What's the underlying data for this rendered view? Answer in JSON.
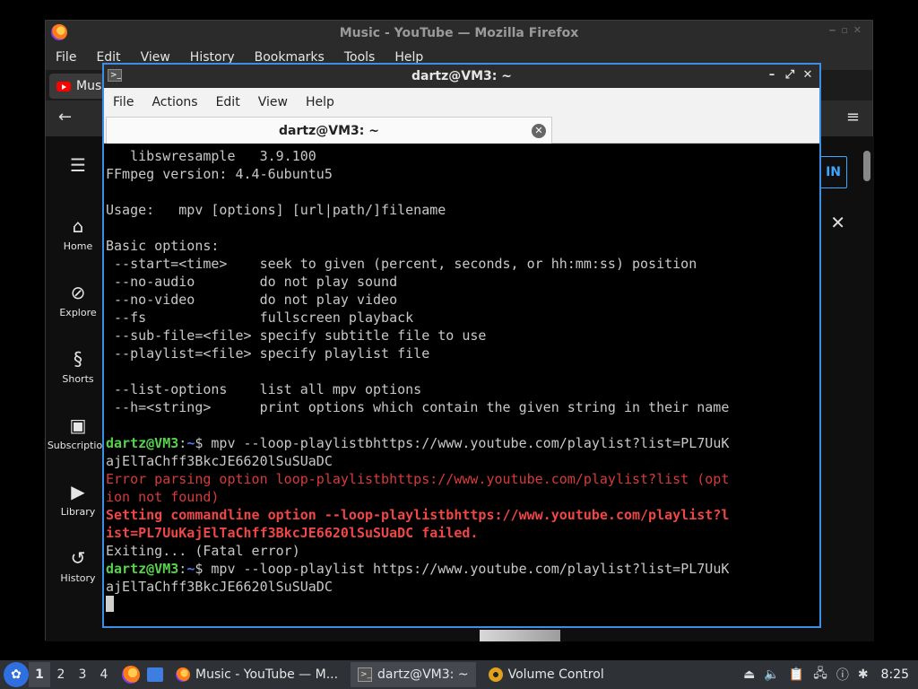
{
  "firefox": {
    "title": "Music - YouTube — Mozilla Firefox",
    "menu": [
      "File",
      "Edit",
      "View",
      "History",
      "Bookmarks",
      "Tools",
      "Help"
    ],
    "tab_label": "Musi",
    "youtube": {
      "sidebar": [
        {
          "label": "Home",
          "icon": "home-icon",
          "glyph": "⌂"
        },
        {
          "label": "Explore",
          "icon": "compass-icon",
          "glyph": "⊘"
        },
        {
          "label": "Shorts",
          "icon": "shorts-icon",
          "glyph": "§"
        },
        {
          "label": "Subscription",
          "icon": "subscriptions-icon",
          "glyph": "▣"
        },
        {
          "label": "Library",
          "icon": "library-icon",
          "glyph": "▶"
        },
        {
          "label": "History",
          "icon": "history-icon",
          "glyph": "↺"
        }
      ],
      "signin_partial": "IN"
    }
  },
  "terminal": {
    "title": "dartz@VM3: ~",
    "menu": [
      "File",
      "Actions",
      "Edit",
      "View",
      "Help"
    ],
    "tab_title": "dartz@VM3: ~",
    "lines": [
      {
        "segments": [
          {
            "text": "   libswresample   3.9.100",
            "cls": ""
          }
        ]
      },
      {
        "segments": [
          {
            "text": "FFmpeg version: 4.4-6ubuntu5",
            "cls": ""
          }
        ]
      },
      {
        "segments": [
          {
            "text": "",
            "cls": ""
          }
        ]
      },
      {
        "segments": [
          {
            "text": "Usage:   mpv [options] [url|path/]filename",
            "cls": ""
          }
        ]
      },
      {
        "segments": [
          {
            "text": "",
            "cls": ""
          }
        ]
      },
      {
        "segments": [
          {
            "text": "Basic options:",
            "cls": ""
          }
        ]
      },
      {
        "segments": [
          {
            "text": " --start=<time>    seek to given (percent, seconds, or hh:mm:ss) position",
            "cls": ""
          }
        ]
      },
      {
        "segments": [
          {
            "text": " --no-audio        do not play sound",
            "cls": ""
          }
        ]
      },
      {
        "segments": [
          {
            "text": " --no-video        do not play video",
            "cls": ""
          }
        ]
      },
      {
        "segments": [
          {
            "text": " --fs              fullscreen playback",
            "cls": ""
          }
        ]
      },
      {
        "segments": [
          {
            "text": " --sub-file=<file> specify subtitle file to use",
            "cls": ""
          }
        ]
      },
      {
        "segments": [
          {
            "text": " --playlist=<file> specify playlist file",
            "cls": ""
          }
        ]
      },
      {
        "segments": [
          {
            "text": "",
            "cls": ""
          }
        ]
      },
      {
        "segments": [
          {
            "text": " --list-options    list all mpv options",
            "cls": ""
          }
        ]
      },
      {
        "segments": [
          {
            "text": " --h=<string>      print options which contain the given string in their name",
            "cls": ""
          }
        ]
      },
      {
        "segments": [
          {
            "text": "",
            "cls": ""
          }
        ]
      },
      {
        "segments": [
          {
            "text": "dartz@VM3",
            "cls": "prompt"
          },
          {
            "text": ":",
            "cls": ""
          },
          {
            "text": "~",
            "cls": "tilde"
          },
          {
            "text": "$ mpv --loop-playlistbhttps://www.youtube.com/playlist?list=PL7UuK",
            "cls": ""
          }
        ]
      },
      {
        "segments": [
          {
            "text": "ajElTaChff3BkcJE6620lSuSUaDC",
            "cls": ""
          }
        ]
      },
      {
        "segments": [
          {
            "text": "Error parsing option loop-playlistbhttps://www.youtube.com/playlist?list (opt",
            "cls": "err"
          }
        ]
      },
      {
        "segments": [
          {
            "text": "ion not found)",
            "cls": "err"
          }
        ]
      },
      {
        "segments": [
          {
            "text": "Setting commandline option --loop-playlistbhttps://www.youtube.com/playlist?l",
            "cls": "errb"
          }
        ]
      },
      {
        "segments": [
          {
            "text": "ist=PL7UuKajElTaChff3BkcJE6620lSuSUaDC failed.",
            "cls": "errb"
          }
        ]
      },
      {
        "segments": [
          {
            "text": "Exiting... (Fatal error)",
            "cls": ""
          }
        ]
      },
      {
        "segments": [
          {
            "text": "dartz@VM3",
            "cls": "prompt"
          },
          {
            "text": ":",
            "cls": ""
          },
          {
            "text": "~",
            "cls": "tilde"
          },
          {
            "text": "$ mpv --loop-playlist https://www.youtube.com/playlist?list=PL7UuK",
            "cls": ""
          }
        ]
      },
      {
        "segments": [
          {
            "text": "ajElTaChff3BkcJE6620lSuSUaDC",
            "cls": ""
          }
        ]
      }
    ]
  },
  "taskbar": {
    "workspaces": [
      "1",
      "2",
      "3",
      "4"
    ],
    "tasks": [
      {
        "label": "Music - YouTube — M...",
        "icon": "firefox-icon"
      },
      {
        "label": "dartz@VM3: ~",
        "icon": "terminal-icon"
      },
      {
        "label": "Volume Control",
        "icon": "volume-control-icon"
      }
    ],
    "clock": "8:25"
  }
}
